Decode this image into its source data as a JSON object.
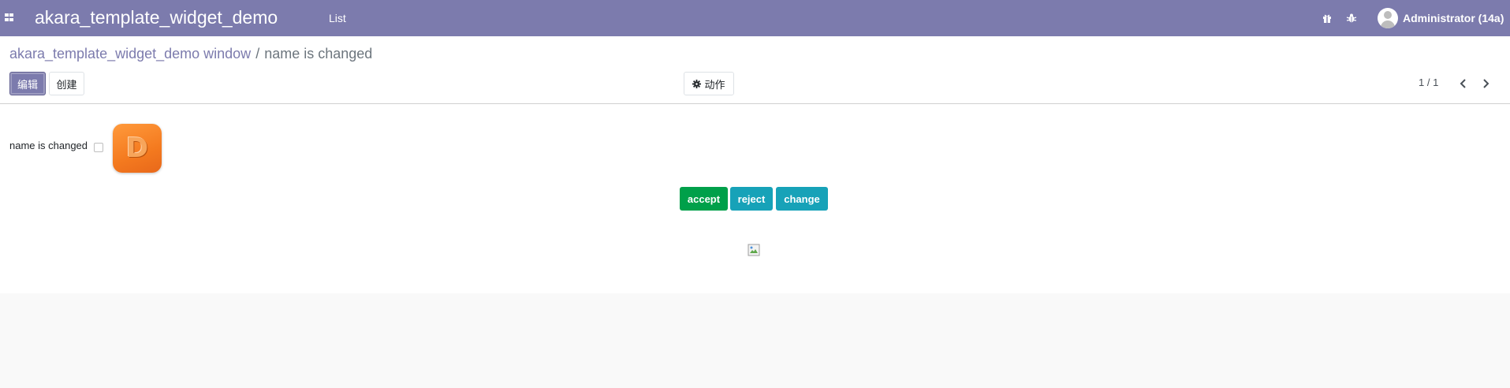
{
  "navbar": {
    "apps_icon": "apps-grid-icon",
    "brand": "akara_template_widget_demo",
    "menu_list": "List",
    "right_icons": [
      "gift-icon",
      "bug-icon"
    ],
    "user_name": "Administrator (14a)",
    "bg_color": "#7c7bad"
  },
  "control_panel": {
    "breadcrumb": {
      "parent": "akara_template_widget_demo window",
      "separator": "/",
      "current": "name is changed"
    },
    "edit_label": "编辑",
    "create_label": "创建",
    "action_label": "动作",
    "action_icon": "gear-icon",
    "pager": "1 / 1"
  },
  "form": {
    "field_label": "name is changed",
    "checkbox_checked": false,
    "logo_letter": "D",
    "buttons": {
      "accept": "accept",
      "reject": "reject",
      "change": "change"
    },
    "colors": {
      "accept": "#00a04a",
      "reject": "#17a2b8",
      "change": "#17a2b8"
    }
  }
}
